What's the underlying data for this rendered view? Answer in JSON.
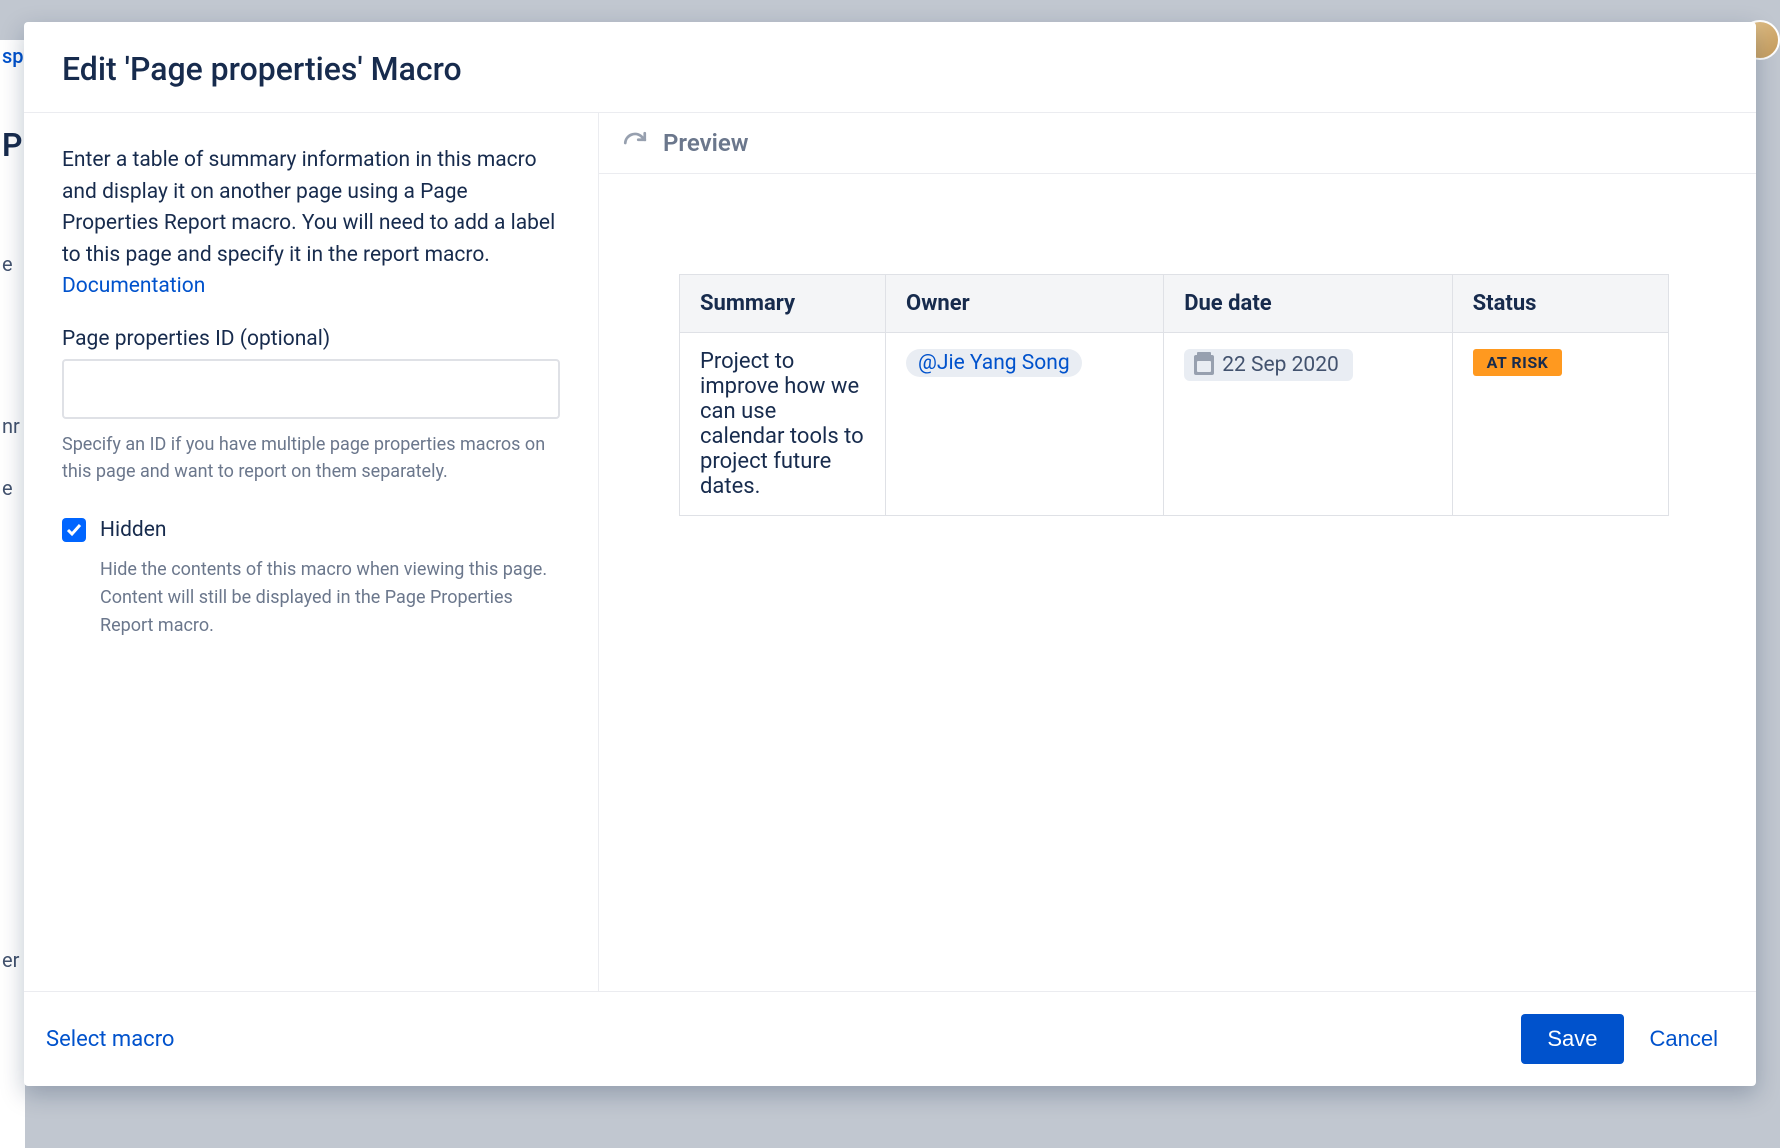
{
  "dialog": {
    "title": "Edit 'Page properties' Macro"
  },
  "config": {
    "description_prefix": "Enter a table of summary information in this macro and display it on another page using a Page Properties Report macro. You will need to add a label to this page and specify it in the report macro. ",
    "documentation_link": "Documentation",
    "id_label": "Page properties ID (optional)",
    "id_value": "",
    "id_help": "Specify an ID if you have multiple page properties macros on this page and want to report on them separately.",
    "hidden_label": "Hidden",
    "hidden_checked": true,
    "hidden_help": "Hide the contents of this macro when viewing this page. Content will still be displayed in the Page Properties Report macro."
  },
  "preview": {
    "heading": "Preview",
    "columns": {
      "summary": "Summary",
      "owner": "Owner",
      "due_date": "Due date",
      "status": "Status"
    },
    "row": {
      "summary": "Project to improve how we can use calendar tools to project future dates.",
      "owner_mention": "@Jie Yang Song",
      "due_date": "22 Sep 2020",
      "status_label": "AT RISK"
    }
  },
  "footer": {
    "select_macro": "Select macro",
    "save": "Save",
    "cancel": "Cancel"
  },
  "colors": {
    "primary": "#0052cc",
    "status_at_risk": "#ff991f"
  }
}
